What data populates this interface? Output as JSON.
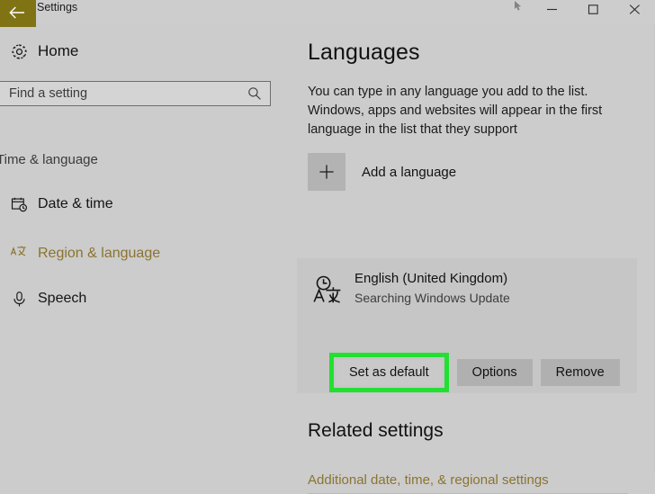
{
  "window": {
    "title": "Settings",
    "back_icon": "back-arrow-icon",
    "controls": {
      "minimize": "–",
      "maximize": "□",
      "close": "✕"
    }
  },
  "sidebar": {
    "home": {
      "label": "Home",
      "icon": "gear-icon"
    },
    "search": {
      "placeholder": "Find a setting",
      "value": "",
      "icon": "search-icon"
    },
    "section_label": "Time & language",
    "items": [
      {
        "label": "Date & time",
        "icon": "calendar-clock-icon",
        "active": false
      },
      {
        "label": "Region & language",
        "icon": "language-translate-icon",
        "active": true
      },
      {
        "label": "Speech",
        "icon": "microphone-icon",
        "active": false
      }
    ]
  },
  "main": {
    "title": "Languages",
    "description": "You can type in any language you add to the list. Windows, apps and websites will appear in the first language in the list that they support",
    "add_language": {
      "label": "Add a language",
      "icon": "plus-icon"
    },
    "language_card": {
      "icon": "language-translate-icon",
      "name": "English (United Kingdom)",
      "status": "Searching Windows Update",
      "buttons": [
        {
          "label": "Set as default",
          "highlighted": true
        },
        {
          "label": "Options",
          "highlighted": false
        },
        {
          "label": "Remove",
          "highlighted": false
        }
      ]
    },
    "related": {
      "title": "Related settings",
      "link": "Additional date, time, & regional settings"
    }
  },
  "colors": {
    "accent": "#8a7430",
    "titlebar_block": "#807314",
    "highlight_green": "#22e032",
    "page_background": "#cccccc",
    "card_background": "#c6c6c6",
    "button_background": "#b0b0b0"
  }
}
